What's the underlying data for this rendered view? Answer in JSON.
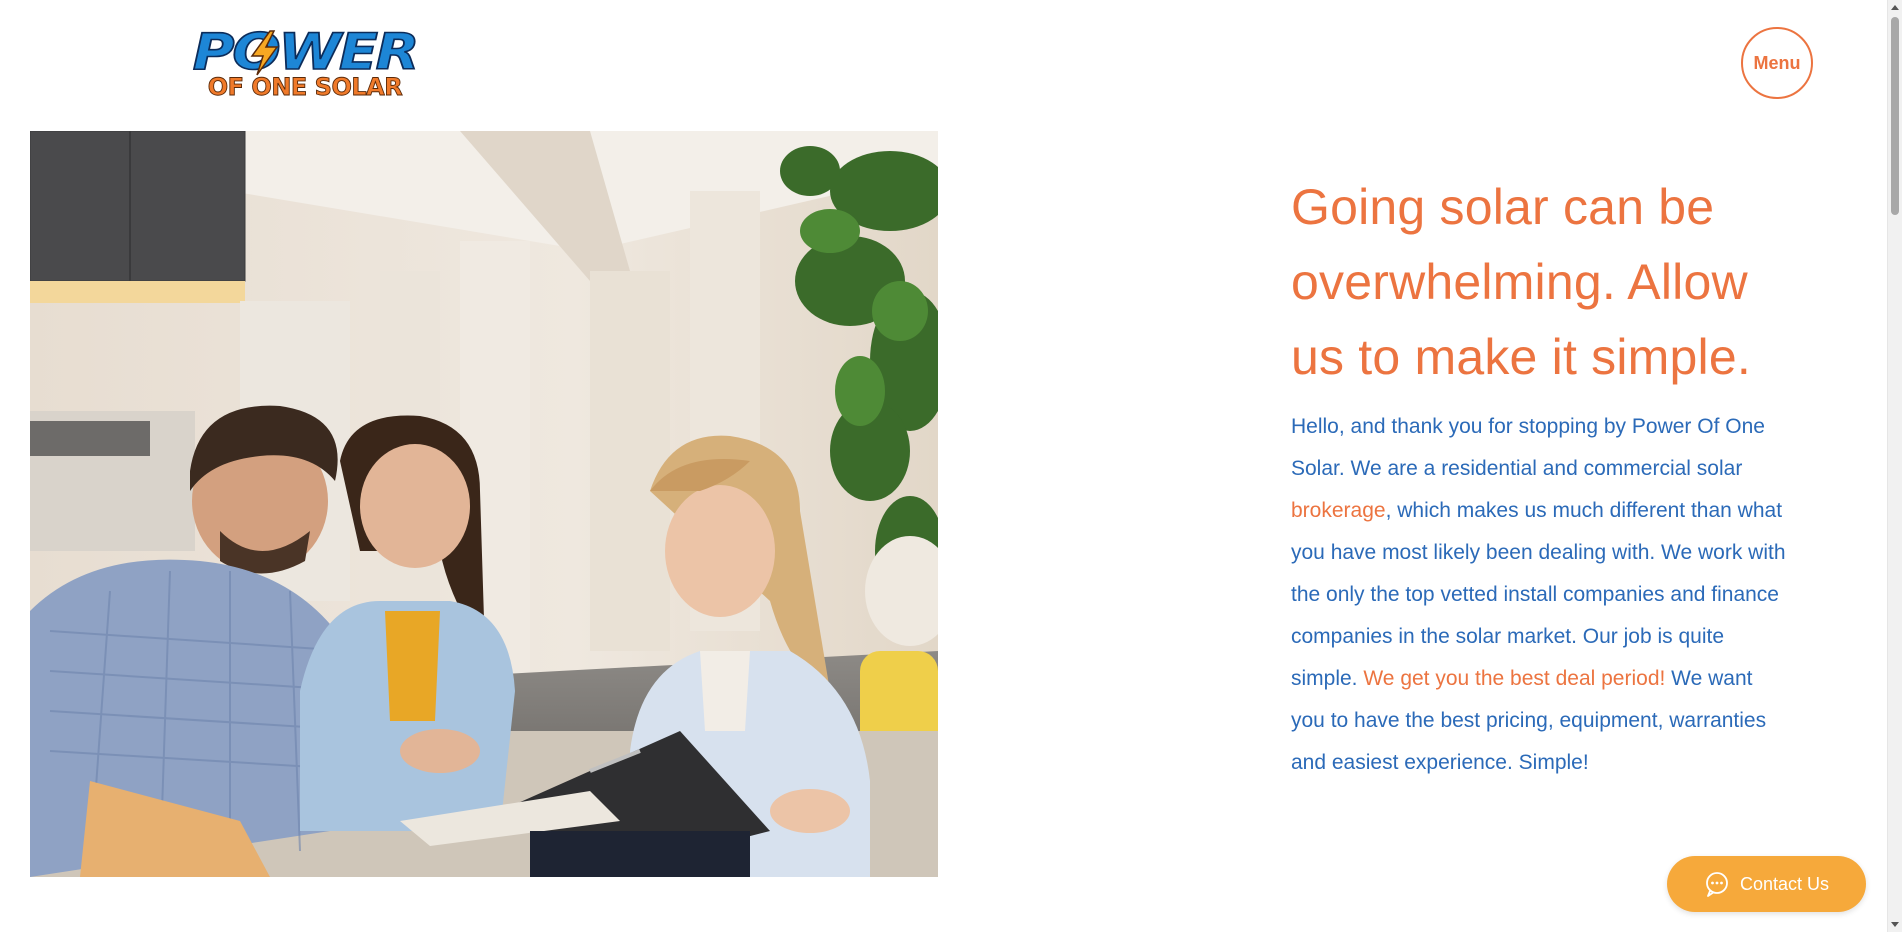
{
  "brand": {
    "logo_word": "POWER",
    "logo_sub": "OF ONE SOLAR",
    "colors": {
      "primary_blue": "#1d86d6",
      "orange": "#ec7440",
      "button_yellow": "#f6a93b",
      "text_blue": "#2b6ab8"
    }
  },
  "header": {
    "menu_label": "Menu"
  },
  "hero": {
    "image_icon": "photo-consultation-image",
    "headline": "Going solar can be overwhelming. Allow us to make it simple.",
    "intro": {
      "part1": "Hello, and thank you for stopping by Power Of One Solar.  We are a residential and commercial solar ",
      "highlight1": "brokerage",
      "part2": ", which makes us much different than what you have most likely been dealing with. We work with the only the top vetted install companies and finance companies in the solar market. Our job is quite simple. ",
      "highlight2": "We get you the best deal period!",
      "part3": "  We want you to have the best pricing, equipment, warranties and easiest experience. Simple!"
    }
  },
  "contact": {
    "label": "Contact Us",
    "icon": "chat-bubble-icon"
  }
}
